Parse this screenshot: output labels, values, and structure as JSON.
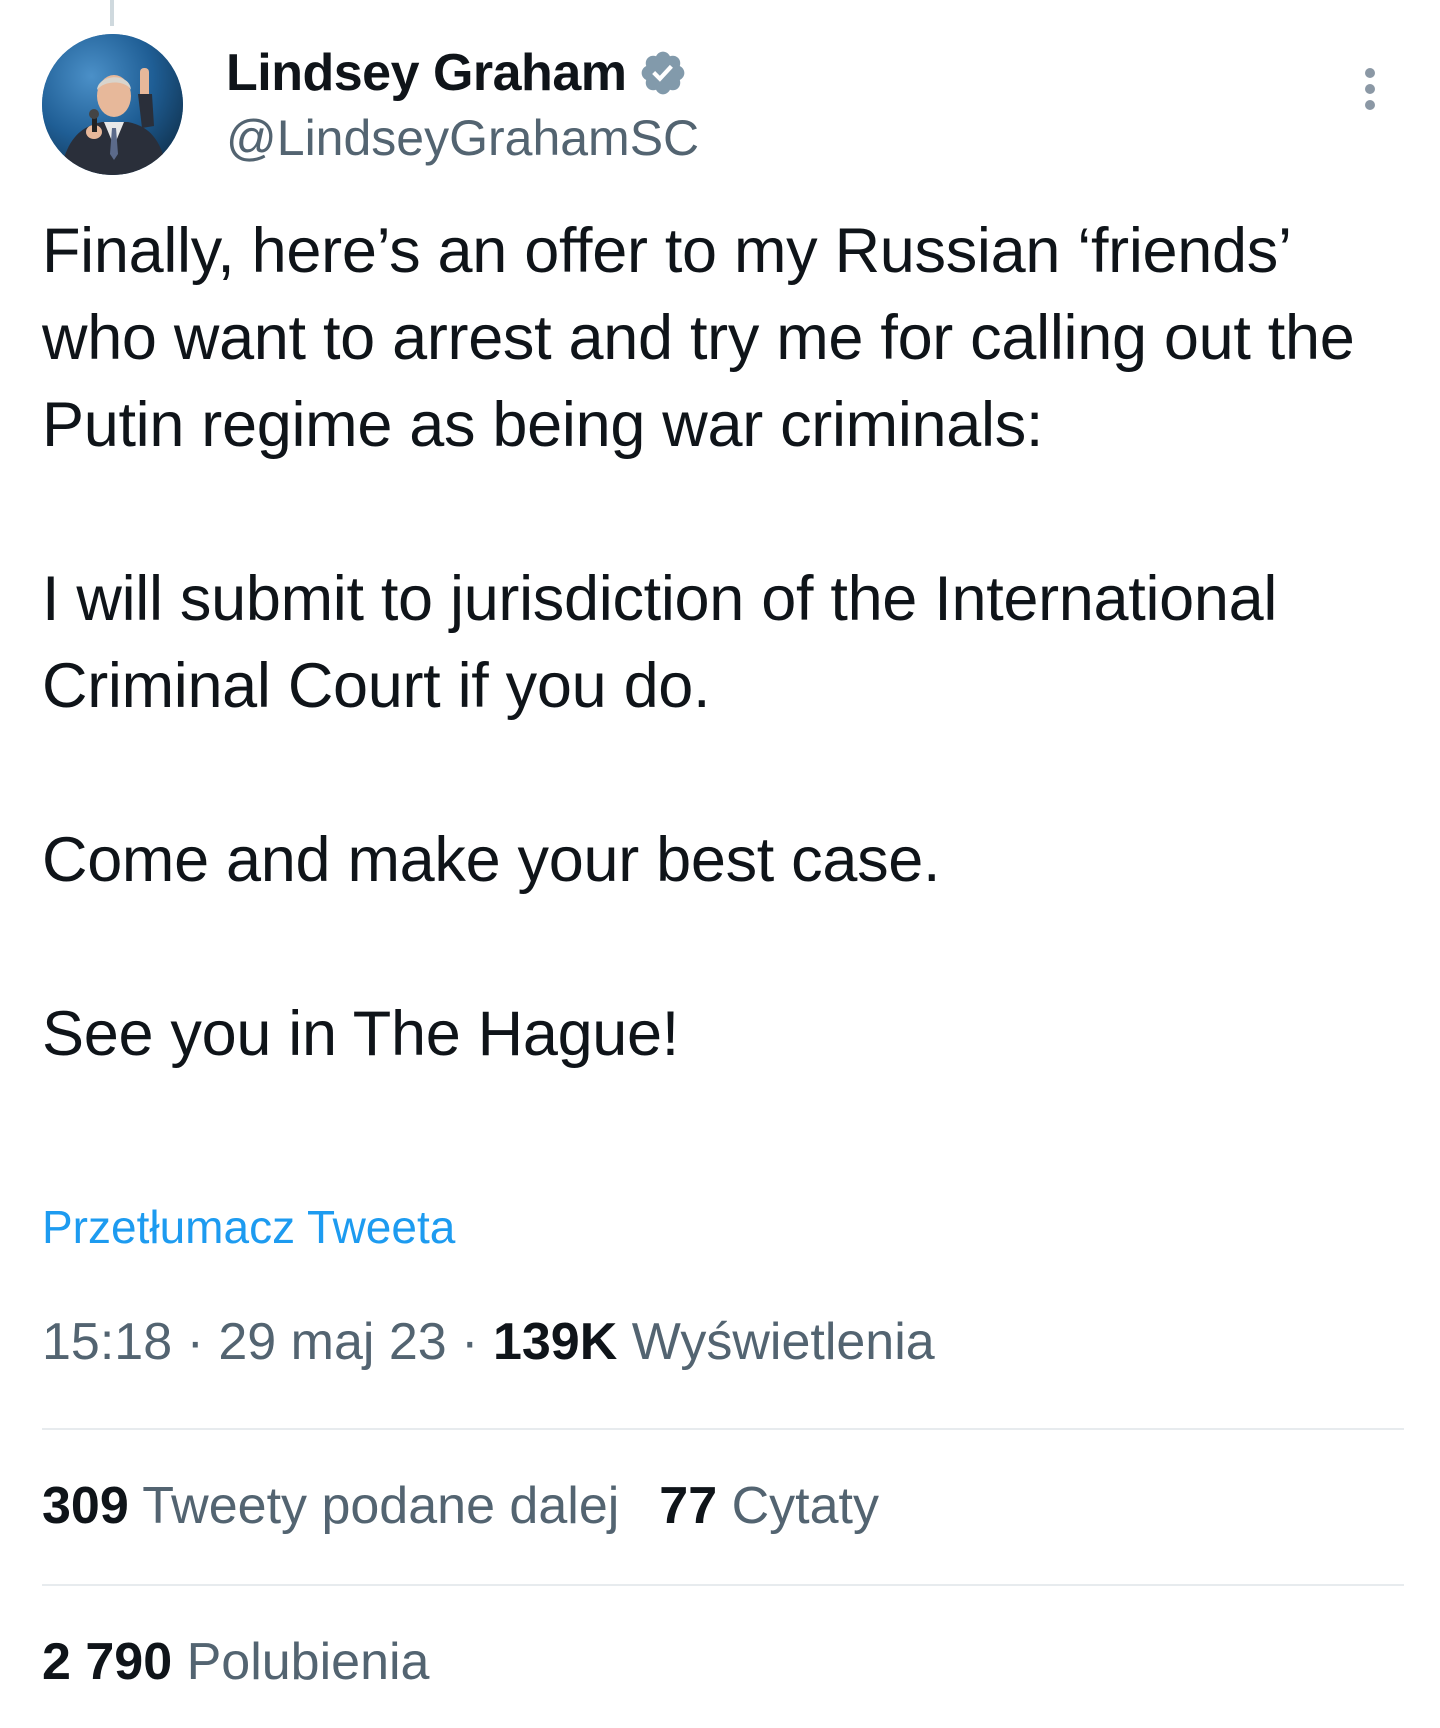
{
  "author": {
    "display_name": "Lindsey Graham",
    "handle": "@LindseyGrahamSC",
    "verified": true
  },
  "tweet": {
    "paragraphs": [
      "Finally, here’s an offer to my Russian ‘friends’ who want to arrest and try me for calling out the Putin regime as being war criminals:",
      "I will submit to jurisdiction of the International Criminal Court if you do.",
      "Come and make your best case.",
      "See you in The Hague!"
    ],
    "translate_label": "Przetłumacz Tweeta"
  },
  "meta": {
    "time": "15:18",
    "separator": " · ",
    "date": "29 maj 23",
    "views_count": "139K",
    "views_label": "Wyświetlenia"
  },
  "stats": {
    "retweets_count": "309",
    "retweets_label": "Tweety podane dalej",
    "quotes_count": "77",
    "quotes_label": "Cytaty",
    "likes_count": "2 790",
    "likes_label": "Polubienia"
  },
  "icons": {
    "verified": "verified-badge-icon",
    "more": "more-options-icon"
  },
  "colors": {
    "link": "#1d9bf0",
    "muted": "#536471",
    "text": "#0f1419",
    "divider": "#e7ebee"
  }
}
